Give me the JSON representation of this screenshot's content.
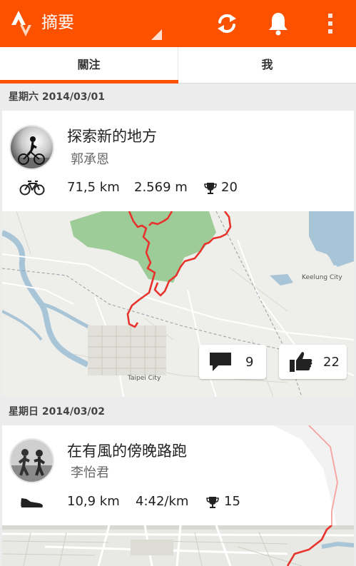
{
  "header": {
    "title": "摘要",
    "accent_color": "#fc5200",
    "icons": [
      "strava-logo-icon",
      "refresh-icon",
      "bell-icon",
      "overflow-menu-icon"
    ]
  },
  "tabs": [
    {
      "label": "關注",
      "selected": true
    },
    {
      "label": "我",
      "selected": false
    }
  ],
  "feed": [
    {
      "date": "星期六 2014/03/01",
      "title": "探索新的地方",
      "athlete": "郭承恩",
      "sport_icon": "bike-icon",
      "distance": "71,5 km",
      "elevation": "2.569 m",
      "achievements": "20",
      "comments": "9",
      "kudos": "22",
      "map_labels": [
        "Keelung City",
        "Taipei City"
      ]
    },
    {
      "date": "星期日 2014/03/02",
      "title": "在有風的傍晚路跑",
      "athlete": "李怡君",
      "sport_icon": "running-shoe-icon",
      "distance": "10,9 km",
      "pace": "4:42/km",
      "achievements": "15"
    }
  ]
}
